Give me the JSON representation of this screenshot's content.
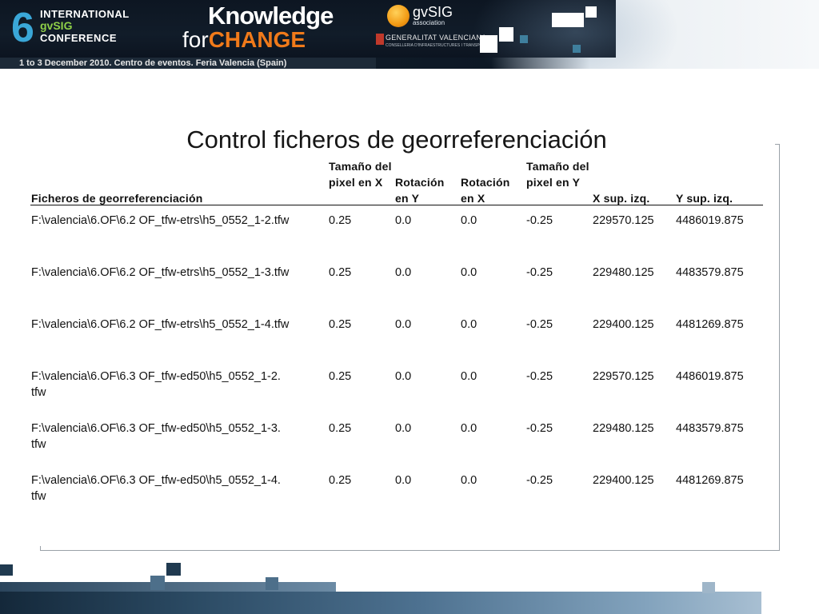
{
  "banner": {
    "number": "6",
    "line1": "INTERNATIONAL",
    "line2": "gvSIG",
    "line3": "CONFERENCE",
    "tagline_top": "Knowledge",
    "tagline_for": "for",
    "tagline_change": "CHANGE",
    "association": "gvSIG",
    "association_sub": "association",
    "gva": "GENERALITAT VALENCIANA",
    "gva_sub": "CONSELLERIA D'INFRAESTRUCTURES I TRANSPORT",
    "date_line": "1 to 3 December 2010. Centro de eventos. Feria Valencia (Spain)"
  },
  "slide": {
    "title": "Control ficheros de georreferenciación"
  },
  "table": {
    "headers": [
      "Ficheros de georreferenciación",
      "Tamaño del pixel en X",
      "Rotación en Y",
      "Rotación en X",
      "Tamaño del pixel en Y",
      "X sup. izq.",
      "Y sup. izq."
    ],
    "rows": [
      {
        "file": "F:\\valencia\\6.OF\\6.2 OF_tfw-etrs\\h5_0552_1-2.tfw",
        "px": "0.25",
        "ry": "0.0",
        "rx": "0.0",
        "py": "-0.25",
        "x": "229570.125",
        "y": "4486019.875"
      },
      {
        "file": "F:\\valencia\\6.OF\\6.2 OF_tfw-etrs\\h5_0552_1-3.tfw",
        "px": "0.25",
        "ry": "0.0",
        "rx": "0.0",
        "py": "-0.25",
        "x": "229480.125",
        "y": "4483579.875"
      },
      {
        "file": "F:\\valencia\\6.OF\\6.2 OF_tfw-etrs\\h5_0552_1-4.tfw",
        "px": "0.25",
        "ry": "0.0",
        "rx": "0.0",
        "py": "-0.25",
        "x": "229400.125",
        "y": "4481269.875"
      },
      {
        "file": "F:\\valencia\\6.OF\\6.3 OF_tfw-ed50\\h5_0552_1-2.\ntfw",
        "px": "0.25",
        "ry": "0.0",
        "rx": "0.0",
        "py": "-0.25",
        "x": "229570.125",
        "y": "4486019.875"
      },
      {
        "file": "F:\\valencia\\6.OF\\6.3 OF_tfw-ed50\\h5_0552_1-3.\ntfw",
        "px": "0.25",
        "ry": "0.0",
        "rx": "0.0",
        "py": "-0.25",
        "x": "229480.125",
        "y": "4483579.875"
      },
      {
        "file": "F:\\valencia\\6.OF\\6.3 OF_tfw-ed50\\h5_0552_1-4.\ntfw",
        "px": "0.25",
        "ry": "0.0",
        "rx": "0.0",
        "py": "-0.25",
        "x": "229400.125",
        "y": "4481269.875"
      }
    ]
  },
  "colors": {
    "banner_dark": "#0d1622",
    "accent_blue": "#3aa7d8",
    "accent_green": "#8fd048",
    "accent_orange": "#f07a1a"
  }
}
